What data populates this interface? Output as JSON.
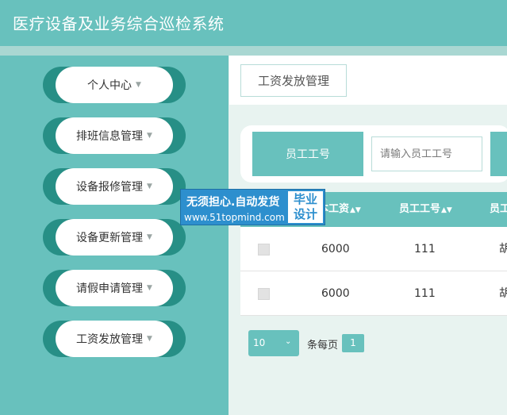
{
  "app": {
    "title": "医疗设备及业务综合巡检系统"
  },
  "sidebar": {
    "items": [
      {
        "label": "个人中心"
      },
      {
        "label": "排班信息管理"
      },
      {
        "label": "设备报修管理"
      },
      {
        "label": "设备更新管理"
      },
      {
        "label": "请假申请管理"
      },
      {
        "label": "工资发放管理"
      }
    ],
    "caret_icon": "▼"
  },
  "main": {
    "breadcrumb": "工资发放管理",
    "search": {
      "label": "员工工号",
      "placeholder": "请输入员工工号"
    },
    "table": {
      "columns": [
        "基本工资",
        "员工工号",
        "员工姓名"
      ],
      "column_display": [
        "本工资",
        "员工工号",
        "员工"
      ],
      "sort_icon": "▲▼",
      "rows": [
        {
          "base_salary": "6000",
          "employee_id": "111",
          "name": "胡"
        },
        {
          "base_salary": "6000",
          "employee_id": "111",
          "name": "胡"
        }
      ]
    },
    "pagination": {
      "page_size": "10",
      "per_page_label": "条每页",
      "current_page": "1"
    }
  },
  "watermark": {
    "line1": "无须担心.自动发货",
    "line2": "www.51topmind.com",
    "badge_line1": "毕业",
    "badge_line2": "设计"
  },
  "colors": {
    "primary": "#68c1bd",
    "dark_teal": "#278f86",
    "background": "#e8f3f0",
    "watermark_blue": "#2d8fce"
  }
}
